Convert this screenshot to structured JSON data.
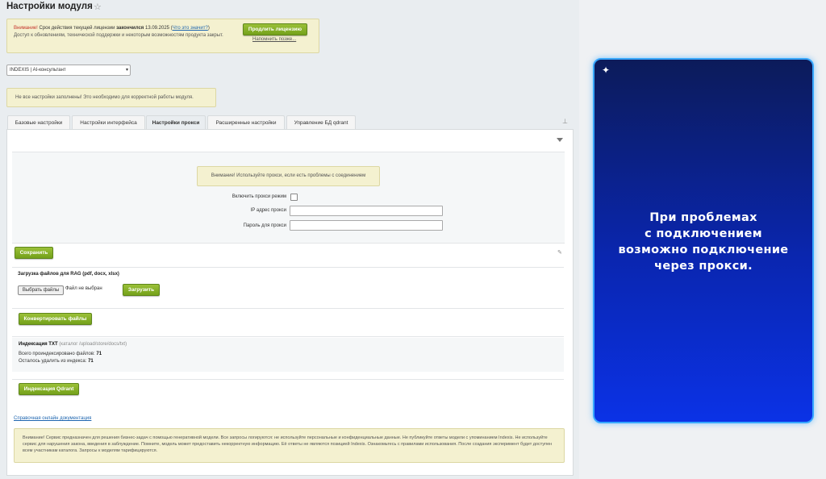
{
  "page": {
    "title": "Настройки модуля"
  },
  "license_warning": {
    "label": "Внимание!",
    "text_before": " Срок действия текущей лицензии ",
    "status": "закончился",
    "date": " 13.09.2025",
    "link": "Что это значит?",
    "text2": "Доступ к обновлениям, технической поддержки и некоторым возможностям продукта закрыт.",
    "renew_button": "Продлить лицензию",
    "remind_link": "Напомнить позже..."
  },
  "module_select": {
    "value": "INDEXIS | AI-консультант"
  },
  "settings_notice": "Не все настройки заполнены! Это необходимо для корректной работы модуля.",
  "tabs": [
    {
      "label": "Базовые настройки"
    },
    {
      "label": "Настройки интерфейса"
    },
    {
      "label": "Настройки прокси"
    },
    {
      "label": "Расширенные настройки"
    },
    {
      "label": "Управление БД qdrant"
    }
  ],
  "proxy": {
    "notice": "Внимание! Используйте прокси, если есть проблемы с соединением",
    "enable_label": "Включить прокси режим",
    "enabled": false,
    "ip_label": "IP адрес прокси",
    "ip_value": "",
    "password_label": "Пароль для прокси",
    "password_value": ""
  },
  "save_button": "Сохранить",
  "rag": {
    "title": "Загрузка файлов для RAG (pdf, docx, xlsx)",
    "choose_button": "Выбрать файлы",
    "no_file": "Файл не выбран",
    "upload_button": "Загрузить"
  },
  "convert_button": "Конвертировать файлы",
  "indexing": {
    "title": "Индексация TXT",
    "dir": " (каталог /upload/store/docs/txt)",
    "indexed_label": "Всего проиндексировано файлов: ",
    "indexed_count": "71",
    "remove_label": "Осталось удалить из индекса: ",
    "remove_count": "71"
  },
  "qdrant_button": "Индексация Qdrant",
  "doc_link": "Справочная онлайн документация",
  "footer_notice": "Внимание! Сервис предназначен для решения бизнес-задач с помощью генеративной модели. Все запросы логируются: не используйте персональные и конфиденциальные данные. Не публикуйте ответы модели с упоминанием Indexis. Не используйте сервис для нарушения закона, введения в заблуждение. Помните, модель может предоставить некорректную информацию. Её ответы не являются позицией Indexis. Ознакомьтесь с правилами использования. После создания эксперимент будет доступен всем участникам каталога. Запросы к моделям тарифицируются.",
  "promo_card": {
    "sparkle_icon": "✦",
    "text": "При проблемах\nс подключением\nвозможно подключение\nчерез прокси."
  }
}
